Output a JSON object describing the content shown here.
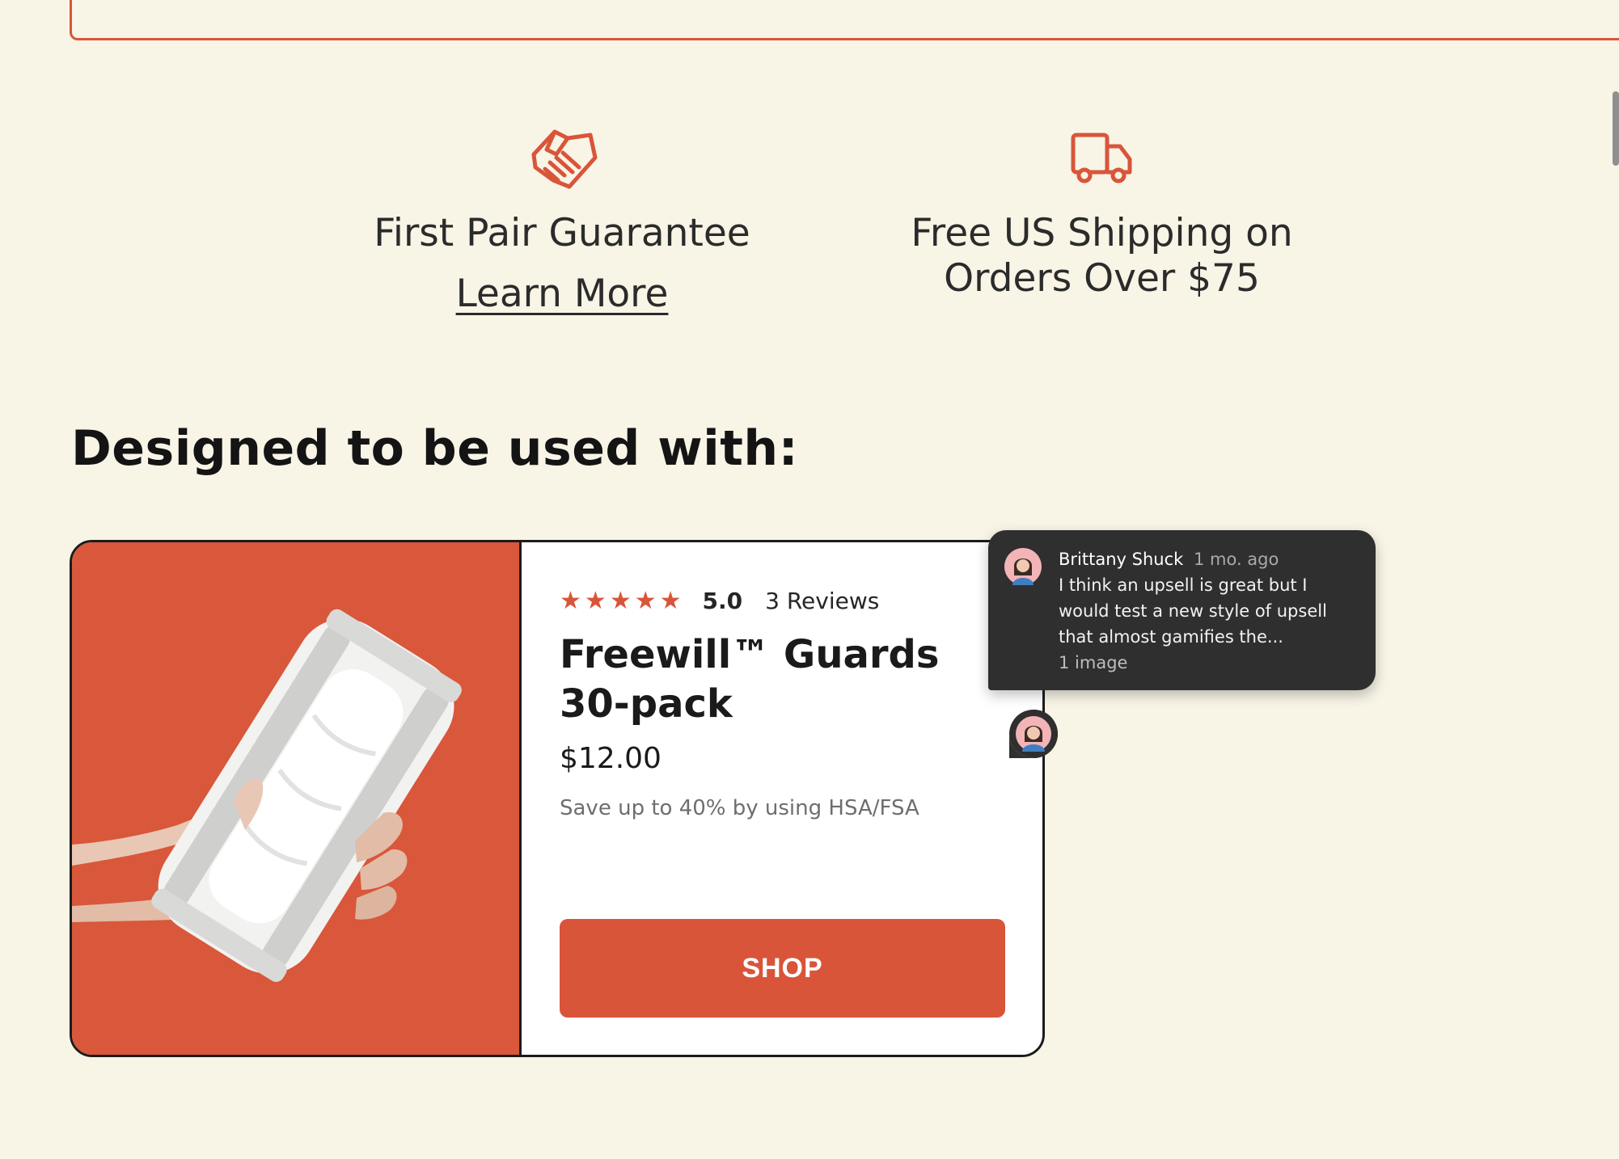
{
  "features": {
    "guarantee": {
      "icon": "handshake-icon",
      "title": "First Pair Guarantee",
      "link_label": "Learn More"
    },
    "shipping": {
      "icon": "truck-icon",
      "title_line1": "Free US Shipping on",
      "title_line2": "Orders Over $75"
    }
  },
  "section": {
    "heading": "Designed to be used with:"
  },
  "product": {
    "image": "product-guard-in-hand",
    "rating": {
      "stars": 5,
      "value": "5.0",
      "reviews_label": "3 Reviews"
    },
    "title_line1": "Freewill™ Guards",
    "title_line2": "30-pack",
    "price": "$12.00",
    "hsa_note": "Save up to 40% by using HSA/FSA",
    "shop_label": "SHOP"
  },
  "comment": {
    "author": "Brittany Shuck",
    "time": "1 mo. ago",
    "text_line1": "I think an upsell is great but I",
    "text_line2": "would test a new style of upsell",
    "text_line3": "that almost gamifies the...",
    "attachment": "1 image",
    "avatar": "user-avatar"
  },
  "colors": {
    "background": "#f8f4e6",
    "accent": "#d9553a",
    "card_border": "#1c1c1c",
    "popup_bg": "#2f2f2f"
  }
}
